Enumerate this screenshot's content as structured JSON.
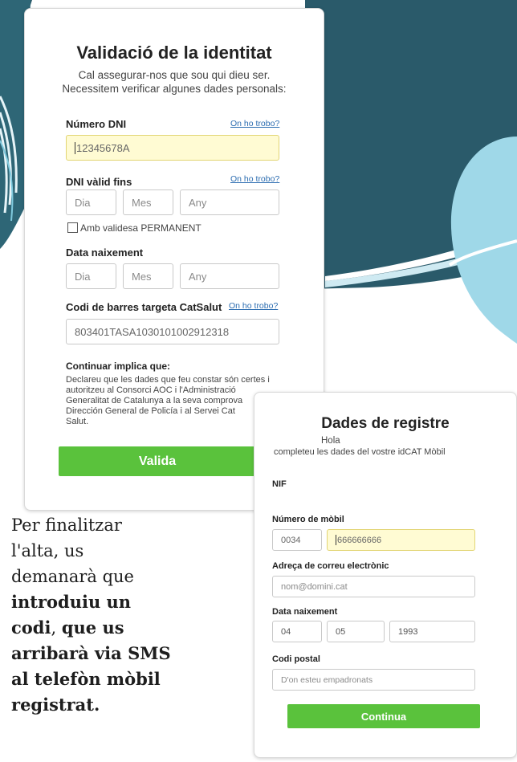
{
  "colors": {
    "teal_dark": "#2a5a6a",
    "teal_light": "#9fd8e8",
    "button_green": "#5ac23c",
    "highlight_yellow": "#fffbd3",
    "link_blue": "#2b6cb0"
  },
  "validation": {
    "title": "Validació de la identitat",
    "subtitle_line1": "Cal assegurar-nos que sou qui dieu ser.",
    "subtitle_line2": "Necessitem verificar algunes dades personals:",
    "dni_label": "Número DNI",
    "dni_help": "On ho trobo?",
    "dni_value": "12345678A",
    "valid_label": "DNI vàlid fins",
    "valid_help": "On ho trobo?",
    "day_placeholder": "Dia",
    "month_placeholder": "Mes",
    "year_placeholder": "Any",
    "permanent_label": "Amb validesa PERMANENT",
    "birth_label": "Data naixement",
    "birth_day": "Dia",
    "birth_month": "Mes",
    "birth_year": "Any",
    "catsalut_label": "Codi de barres targeta CatSalut",
    "catsalut_help": "On ho trobo?",
    "catsalut_value": "803401TASA1030101002912318",
    "consent_title": "Continuar implica que:",
    "consent_lines": [
      "Declareu que les dades que feu constar són certes i",
      "autoritzeu al Consorci AOC i l'Administració",
      "Generalitat de Catalunya a la seva comprova",
      "Dirección General de Policía i al Servei Cat",
      "Salut."
    ],
    "button_label": "Valida"
  },
  "registration": {
    "title": "Dades de registre",
    "greeting": "Hola",
    "subtitle": "completeu les dades del vostre idCAT Mòbil",
    "nif_label": "NIF",
    "mobile_label": "Número de mòbil",
    "country_code": "0034",
    "mobile_value": "666666666",
    "email_label": "Adreça de correu electrònic",
    "email_placeholder": "nom@domini.cat",
    "birth_label": "Data naixement",
    "birth_day": "04",
    "birth_month": "05",
    "birth_year": "1993",
    "postal_label": "Codi postal",
    "postal_placeholder": "D'on esteu empadronats",
    "button_label": "Continua"
  },
  "caption": {
    "line1": "Per finalitzar",
    "line2": "l'alta, us",
    "line3": "demanarà que",
    "bold1": "introduiu un",
    "bold2": "codi",
    "sep": ", ",
    "bold3": "que us",
    "bold4": "arribarà via SMS",
    "bold5": "al telefòn mòbil",
    "bold6": "registrat."
  }
}
